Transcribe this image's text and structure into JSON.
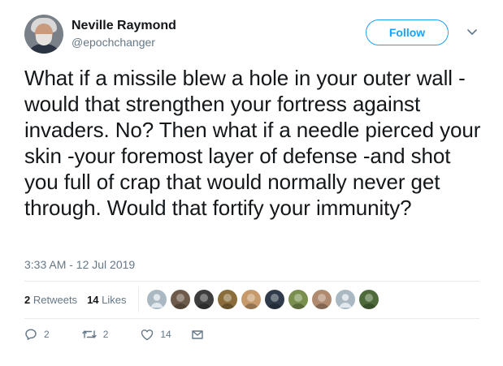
{
  "user": {
    "name": "Neville Raymond",
    "handle": "@epochchanger"
  },
  "follow_label": "Follow",
  "tweet_text": "What if a missile blew a hole in your outer wall - would that strengthen your fortress against invaders. No? Then what if a needle pierced your skin -your foremost layer of defense -and shot you full of crap that would normally never get through. Would that fortify your immunity?",
  "timestamp": "3:33 AM - 12 Jul 2019",
  "stats": {
    "retweets_count": "2",
    "retweets_label": "Retweets",
    "likes_count": "14",
    "likes_label": "Likes"
  },
  "likers": [
    {
      "icon": "default-avatar",
      "bg": "#aab8c2"
    },
    {
      "icon": "photo-avatar",
      "bg": "#6e5a4a"
    },
    {
      "icon": "logo-avatar",
      "bg": "#3d3d3d"
    },
    {
      "icon": "flag-avatar",
      "bg": "#8a6d3b"
    },
    {
      "icon": "photo-avatar",
      "bg": "#c79a6b"
    },
    {
      "icon": "photo-avatar",
      "bg": "#2f3b4a"
    },
    {
      "icon": "photo-avatar",
      "bg": "#7a8f4e"
    },
    {
      "icon": "photo-avatar",
      "bg": "#b08a6e"
    },
    {
      "icon": "default-avatar",
      "bg": "#aab8c2"
    },
    {
      "icon": "photo-avatar",
      "bg": "#4e6a3a"
    }
  ],
  "actions": {
    "reply_count": "2",
    "retweet_count": "2",
    "like_count": "14"
  },
  "colors": {
    "accent": "#1da1f2",
    "text": "#14171a",
    "muted": "#657786",
    "divider": "#e6ecf0"
  }
}
